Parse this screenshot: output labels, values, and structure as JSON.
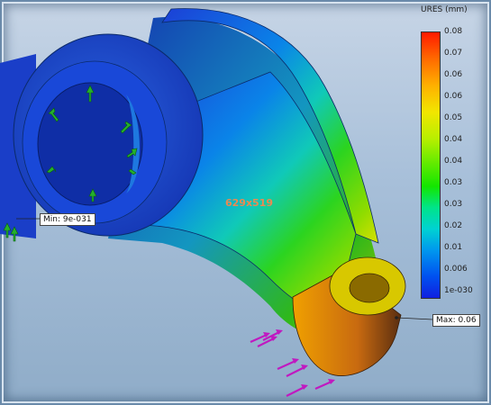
{
  "legend": {
    "title": "URES (mm)",
    "ticks": [
      "0.08",
      "0.07",
      "0.06",
      "0.06",
      "0.05",
      "0.04",
      "0.04",
      "0.03",
      "0.03",
      "0.02",
      "0.01",
      "0.006",
      "1e-030"
    ]
  },
  "callouts": {
    "min_label": "Min: 9e-031",
    "max_label": "Max: 0.06"
  },
  "watermark": "629x519",
  "colors": {
    "background_top": "#c7d5e6",
    "background_bottom": "#8facc8",
    "fixture_arrow": "#24b02c",
    "load_arrow": "#c019c0",
    "low_displacement": "#1a4fd0",
    "high_displacement": "#ff6a00"
  }
}
